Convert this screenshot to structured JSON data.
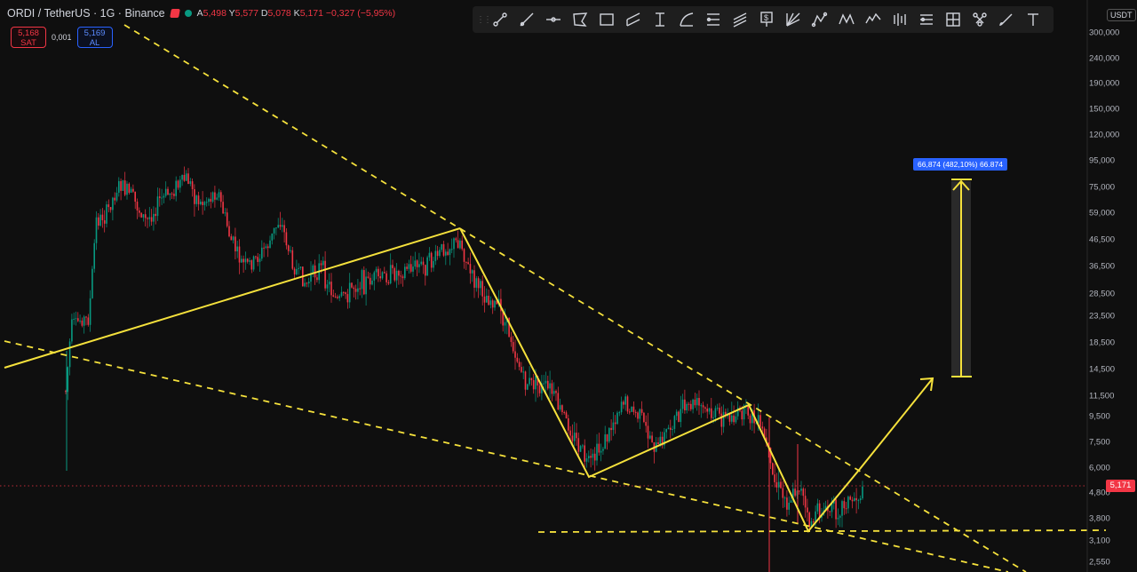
{
  "header": {
    "symbol_title": "ORDI / TetherUS · 1G · Binance",
    "ohlc": [
      {
        "key": "A",
        "value": "5,498"
      },
      {
        "key": "Y",
        "value": "5,577"
      },
      {
        "key": "D",
        "value": "5,078"
      },
      {
        "key": "K",
        "value": "5,171"
      }
    ],
    "change": "−0,327 (−5,95%)"
  },
  "trade": {
    "sell_price": "5,168",
    "sell_label": "SAT",
    "spread": "0,001",
    "buy_price": "5,169",
    "buy_label": "AL"
  },
  "toolbar": {
    "tools": [
      "trend-line-tool-icon",
      "ray-tool-icon",
      "horizontal-line-tool-icon",
      "polygon-tool-icon",
      "rectangle-tool-icon",
      "parallel-channel-tool-icon",
      "date-range-tool-icon",
      "arc-tool-icon",
      "fib-retracement-tool-icon",
      "pitchfork-tool-icon",
      "price-label-tool-icon",
      "gann-fan-tool-icon",
      "pattern-tool-icon",
      "xabcd-pattern-tool-icon",
      "elliott-wave-tool-icon",
      "bar-pattern-tool-icon",
      "long-position-tool-icon",
      "crosshair-frame-tool-icon",
      "network-tool-icon",
      "brush-tool-icon",
      "text-tool-icon"
    ]
  },
  "price_axis": {
    "currency": "USDT",
    "labels": [
      "300,000",
      "240,000",
      "190,000",
      "150,000",
      "120,000",
      "95,000",
      "75,000",
      "59,000",
      "46,500",
      "36,500",
      "28,500",
      "23,500",
      "18,500",
      "14,500",
      "11,500",
      "9,500",
      "7,500",
      "6,000",
      "4,800",
      "3,800",
      "3,100",
      "2,550"
    ],
    "current_price": "5,171"
  },
  "measure_label": "66,874 (482,10%) 66.874",
  "colors": {
    "up": "#089981",
    "down": "#f23645",
    "drawing": "#f5e13c",
    "background": "#0f0f0f"
  }
}
